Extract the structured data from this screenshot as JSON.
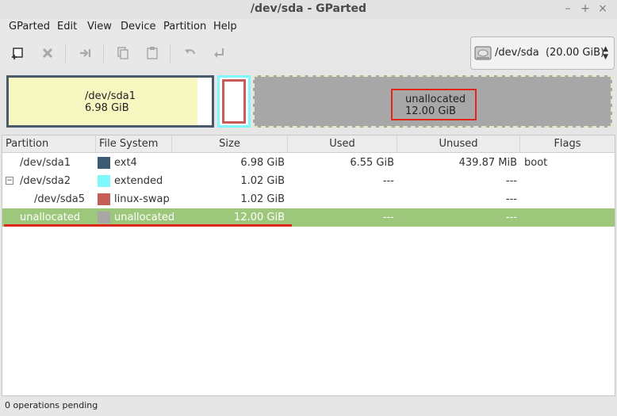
{
  "window": {
    "title": "/dev/sda - GParted",
    "controls": [
      "–",
      "+",
      "×"
    ]
  },
  "menu": [
    "GParted",
    "Edit",
    "View",
    "Device",
    "Partition",
    "Help"
  ],
  "toolbar": {
    "icons": [
      "new-partition-icon",
      "delete-icon",
      "resize-move-icon",
      "copy-icon",
      "paste-icon",
      "undo-icon",
      "apply-icon"
    ]
  },
  "device_selector": {
    "device": "/dev/sda",
    "size": "(20.00 GiB)"
  },
  "visual": {
    "sda1": {
      "name": "/dev/sda1",
      "size": "6.98 GiB",
      "color": "#f7f7c2",
      "border": "#4a5a6a"
    },
    "extended": {
      "border": "#7ef8fb",
      "swap_border": "#c75d57"
    },
    "unallocated": {
      "name": "unallocated",
      "size": "12.00 GiB",
      "color": "#a7a7a7",
      "highlight": "#e0261b"
    }
  },
  "table": {
    "headers": [
      "Partition",
      "File System",
      "Size",
      "Used",
      "Unused",
      "Flags"
    ],
    "rows": [
      {
        "partition": "/dev/sda1",
        "fs": "ext4",
        "fs_color": "#3d5a75",
        "size": "6.98 GiB",
        "used": "6.55 GiB",
        "unused": "439.87 MiB",
        "flags": "boot",
        "indent": 0,
        "expander": ""
      },
      {
        "partition": "/dev/sda2",
        "fs": "extended",
        "fs_color": "#7ef8fb",
        "size": "1.02 GiB",
        "used": "---",
        "unused": "---",
        "flags": "",
        "indent": 0,
        "expander": "−"
      },
      {
        "partition": "/dev/sda5",
        "fs": "linux-swap",
        "fs_color": "#c75d57",
        "size": "1.02 GiB",
        "used": "",
        "unused": "---",
        "flags": "",
        "indent": 1,
        "expander": ""
      },
      {
        "partition": "unallocated",
        "fs": "unallocated",
        "fs_color": "#a7a7a7",
        "size": "12.00 GiB",
        "used": "---",
        "unused": "---",
        "flags": "",
        "indent": 0,
        "expander": "",
        "selected": true
      }
    ]
  },
  "status": {
    "text": "0 operations pending"
  }
}
